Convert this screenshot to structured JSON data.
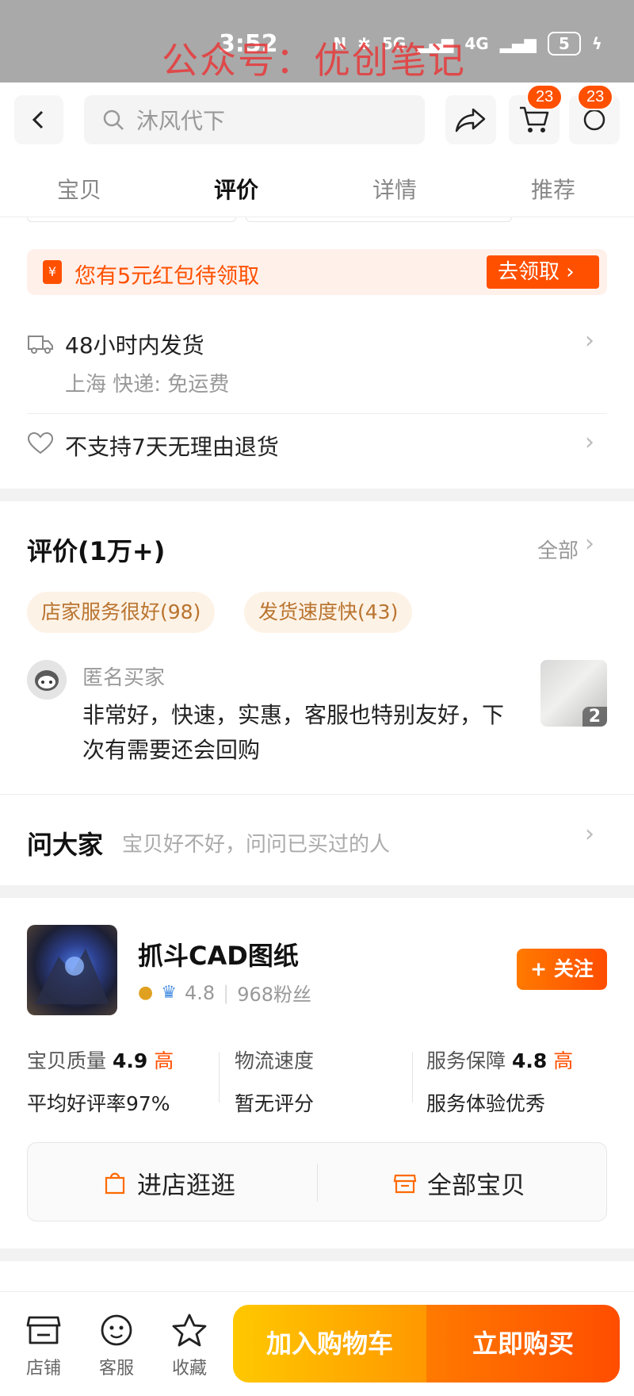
{
  "status_bar": {
    "time": "3:52",
    "network": "5G",
    "network2": "4G",
    "battery": "5"
  },
  "watermark": "公众号：优创笔记",
  "header": {
    "search_placeholder": "沐风代下",
    "cart_badge": "23",
    "message_badge": "23"
  },
  "tabs": [
    "宝贝",
    "评价",
    "详情",
    "推荐"
  ],
  "coupon": {
    "text": "您有5元红包待领取",
    "button": "去领取 ›",
    "icon": "¥"
  },
  "shipping": {
    "title": "48小时内发货",
    "detail": "上海  快递:  免运费"
  },
  "returns": {
    "text": "不支持7天无理由退货"
  },
  "reviews": {
    "title": "评价(1万+)",
    "all_label": "全部",
    "tags": [
      "店家服务很好(98)",
      "发货速度快(43)"
    ],
    "user": "匿名买家",
    "body": "非常好，快速，实惠，客服也特别友好，下次有需要还会回购",
    "image_count": "2"
  },
  "ask": {
    "title": "问大家",
    "subtitle": "宝贝好不好，问问已买过的人"
  },
  "store": {
    "name": "抓斗CAD图纸",
    "rating": "4.8",
    "fans": "968粉丝",
    "follow": "+ 关注",
    "metrics": [
      {
        "label": "宝贝质量",
        "score": "4.9",
        "level": "高",
        "sub": "平均好评率97%"
      },
      {
        "label": "物流速度",
        "score": "",
        "level": "",
        "sub": "暂无评分"
      },
      {
        "label": "服务保障",
        "score": "4.8",
        "level": "高",
        "sub": "服务体验优秀"
      }
    ],
    "buttons": [
      "进店逛逛",
      "全部宝贝"
    ]
  },
  "bottom_bar": {
    "items": [
      "店铺",
      "客服",
      "收藏"
    ],
    "add_to_cart": "加入购物车",
    "buy_now": "立即购买"
  }
}
